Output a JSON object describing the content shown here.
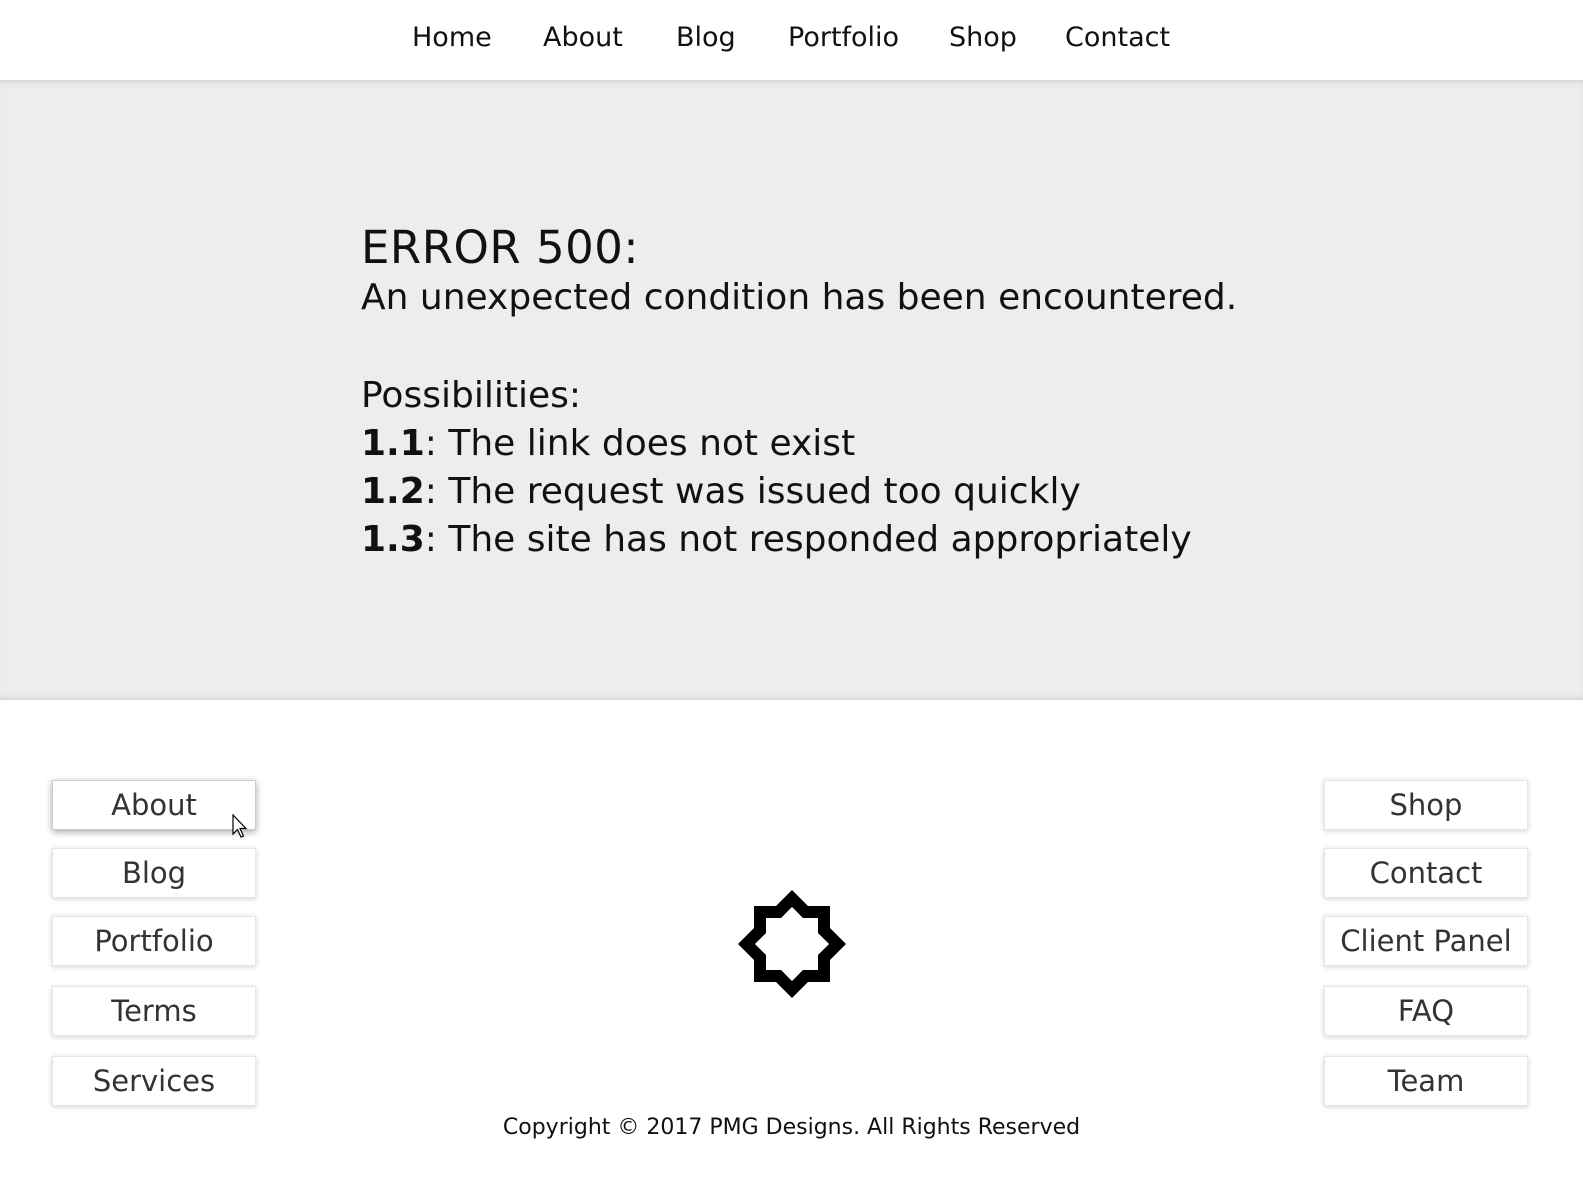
{
  "nav": {
    "items": [
      "Home",
      "About",
      "Blog",
      "Portfolio",
      "Shop",
      "Contact"
    ]
  },
  "error": {
    "title": "ERROR 500:",
    "message": "An unexpected condition has been encountered.",
    "possibilities_label": "Possibilities:",
    "possibilities": [
      {
        "num": "1.1",
        "text": ": The link does not exist"
      },
      {
        "num": "1.2",
        "text": ": The request was issued too quickly"
      },
      {
        "num": "1.3",
        "text": ": The site has not responded appropriately"
      }
    ]
  },
  "footer": {
    "left_links": [
      "About",
      "Blog",
      "Portfolio",
      "Terms",
      "Services"
    ],
    "right_links": [
      "Shop",
      "Contact",
      "Client Panel",
      "FAQ",
      "Team"
    ],
    "logo_icon": "star-outline-icon",
    "copyright": "Copyright © 2017 PMG Designs. All Rights Reserved"
  },
  "colors": {
    "hero_bg": "#ededed",
    "text": "#111111",
    "button_text": "#333333"
  }
}
